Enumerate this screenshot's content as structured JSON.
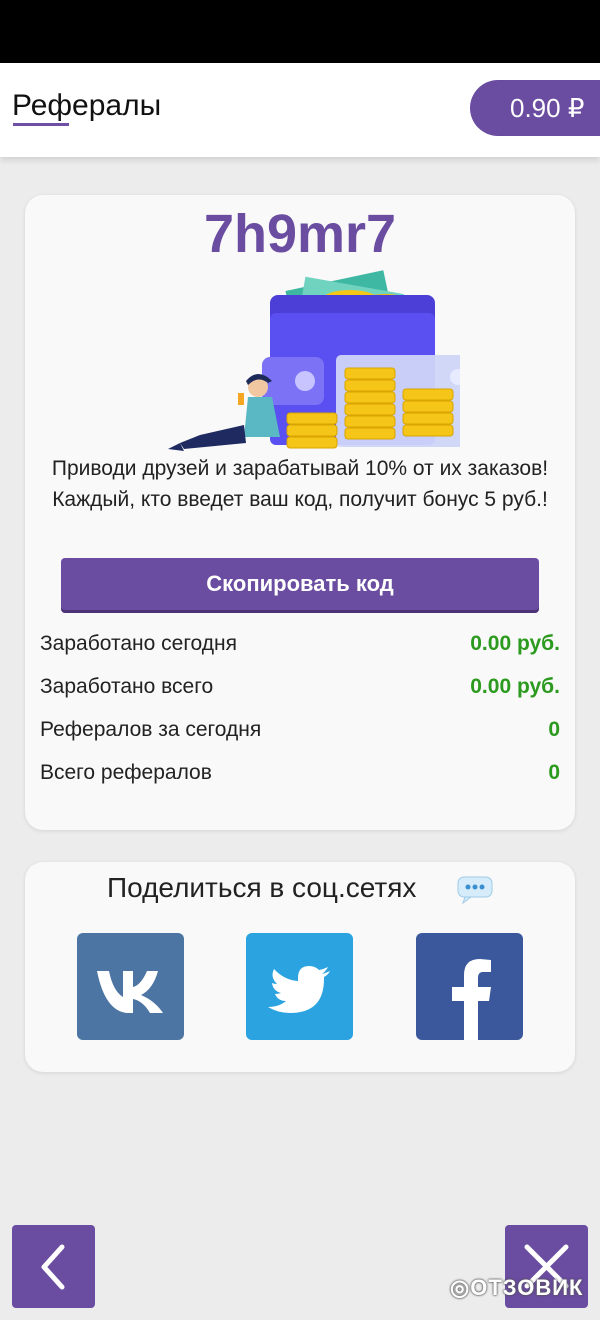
{
  "header": {
    "title": "Рефералы",
    "balance": "0.90 ₽"
  },
  "referral": {
    "code": "7h9mr7",
    "promo_text": "Приводи друзей и зарабатывай 10% от их заказов! Каждый, кто введет ваш код, получит бонус 5 руб.!",
    "copy_button_label": "Скопировать код"
  },
  "stats": [
    {
      "label": "Заработано сегодня",
      "value": "0.00 руб."
    },
    {
      "label": "Заработано всего",
      "value": "0.00 руб."
    },
    {
      "label": "Рефералов за сегодня",
      "value": "0"
    },
    {
      "label": "Всего рефералов",
      "value": "0"
    }
  ],
  "share": {
    "title": "Поделиться в соц.сетях",
    "title_icon": "speech-bubble-icon",
    "networks": [
      {
        "name": "vk",
        "icon": "vk-icon",
        "color": "#4c75a3"
      },
      {
        "name": "twitter",
        "icon": "twitter-bird-icon",
        "color": "#2aa3e0"
      },
      {
        "name": "facebook",
        "icon": "facebook-icon",
        "color": "#3a589b"
      }
    ]
  },
  "nav": {
    "back_icon": "chevron-left-icon",
    "close_icon": "close-icon"
  },
  "watermark": "ОТЗОВИК",
  "colors": {
    "accent": "#6a4ca0",
    "positive": "#2b9a1e",
    "background": "#ececec"
  }
}
